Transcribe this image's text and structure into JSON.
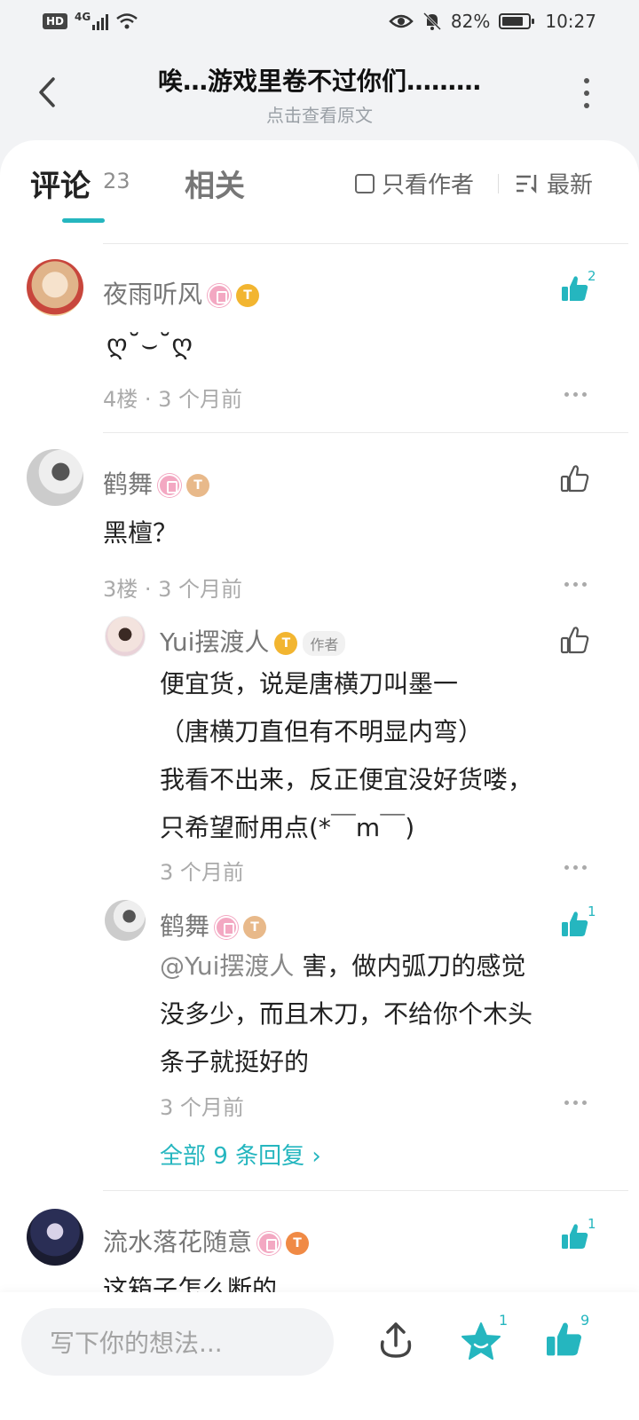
{
  "status_bar": {
    "hd": "HD",
    "network": "4G",
    "battery": "82%",
    "time": "10:27"
  },
  "header": {
    "title": "唉…游戏里卷不过你们………",
    "subtitle": "点击查看原文"
  },
  "tabs": {
    "comments_label": "评论",
    "comments_count": "23",
    "related_label": "相关",
    "author_only_label": "只看作者",
    "sort_label": "最新"
  },
  "comments": [
    {
      "name": "夜雨听风",
      "body": "ღ˘⌣˘ღ",
      "meta": "4楼 · 3 个月前",
      "likes": "2"
    },
    {
      "name": "鹤舞",
      "body": "黑檀？",
      "meta": "3楼 · 3 个月前",
      "likes": "",
      "replies": [
        {
          "name": "Yui摆渡人",
          "author_tag": "作者",
          "lines": [
            "便宜货，说是唐横刀叫墨一",
            "（唐横刀直但有不明显内弯）",
            "我看不出来，反正便宜没好货喽，",
            "只希望耐用点(*￣m￣)"
          ],
          "meta": "3 个月前"
        },
        {
          "name": "鹤舞",
          "mention": "@Yui摆渡人",
          "first_line_rest": "害，做内弧刀的感觉",
          "lines": [
            "没多少，而且木刀，不给你个木头",
            "条子就挺好的"
          ],
          "meta": "3 个月前",
          "likes": "1"
        }
      ],
      "view_all": "全部 9 条回复 ›"
    },
    {
      "name": "流水落花随意",
      "body": "这箱子怎么断的",
      "likes": "1"
    }
  ],
  "bottom_bar": {
    "input_placeholder": "写下你的想法...",
    "star_count": "1",
    "like_count": "9"
  },
  "colors": {
    "accent": "#25b6bf",
    "like_active": "#25b6bf"
  }
}
